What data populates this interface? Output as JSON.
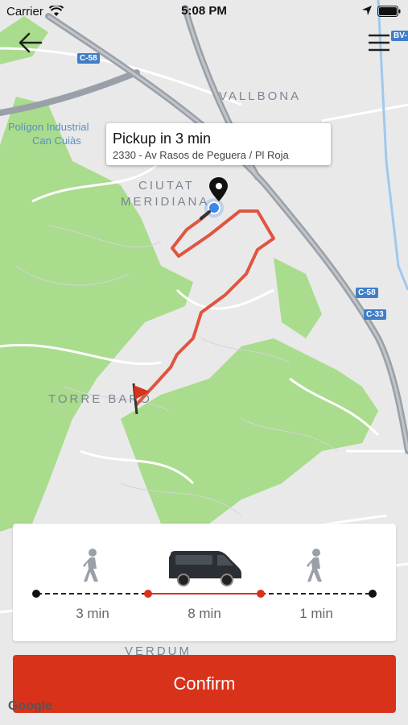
{
  "status_bar": {
    "carrier": "Carrier",
    "time": "5:08 PM"
  },
  "map": {
    "places": [
      "VALLBONA",
      "CIUTAT",
      "MERIDIANA",
      "TORRE BARO",
      "VERDUM"
    ],
    "poi": [
      "Polígon Industrial",
      "Can Cuiàs"
    ],
    "roads": [
      "C-58",
      "C-58",
      "C-33",
      "BV-"
    ]
  },
  "callout": {
    "title": "Pickup in 3 min",
    "address": "2330 - Av Rasos de Peguera / Pl Roja"
  },
  "trip": {
    "segments": [
      {
        "mode": "walk",
        "duration": "3 min"
      },
      {
        "mode": "van",
        "duration": "8 min"
      },
      {
        "mode": "walk",
        "duration": "1 min"
      }
    ]
  },
  "confirm_label": "Confirm",
  "branding": "Google",
  "colors": {
    "accent": "#d9321a",
    "route": "#e0553f",
    "user_dot": "#3c86e8"
  }
}
